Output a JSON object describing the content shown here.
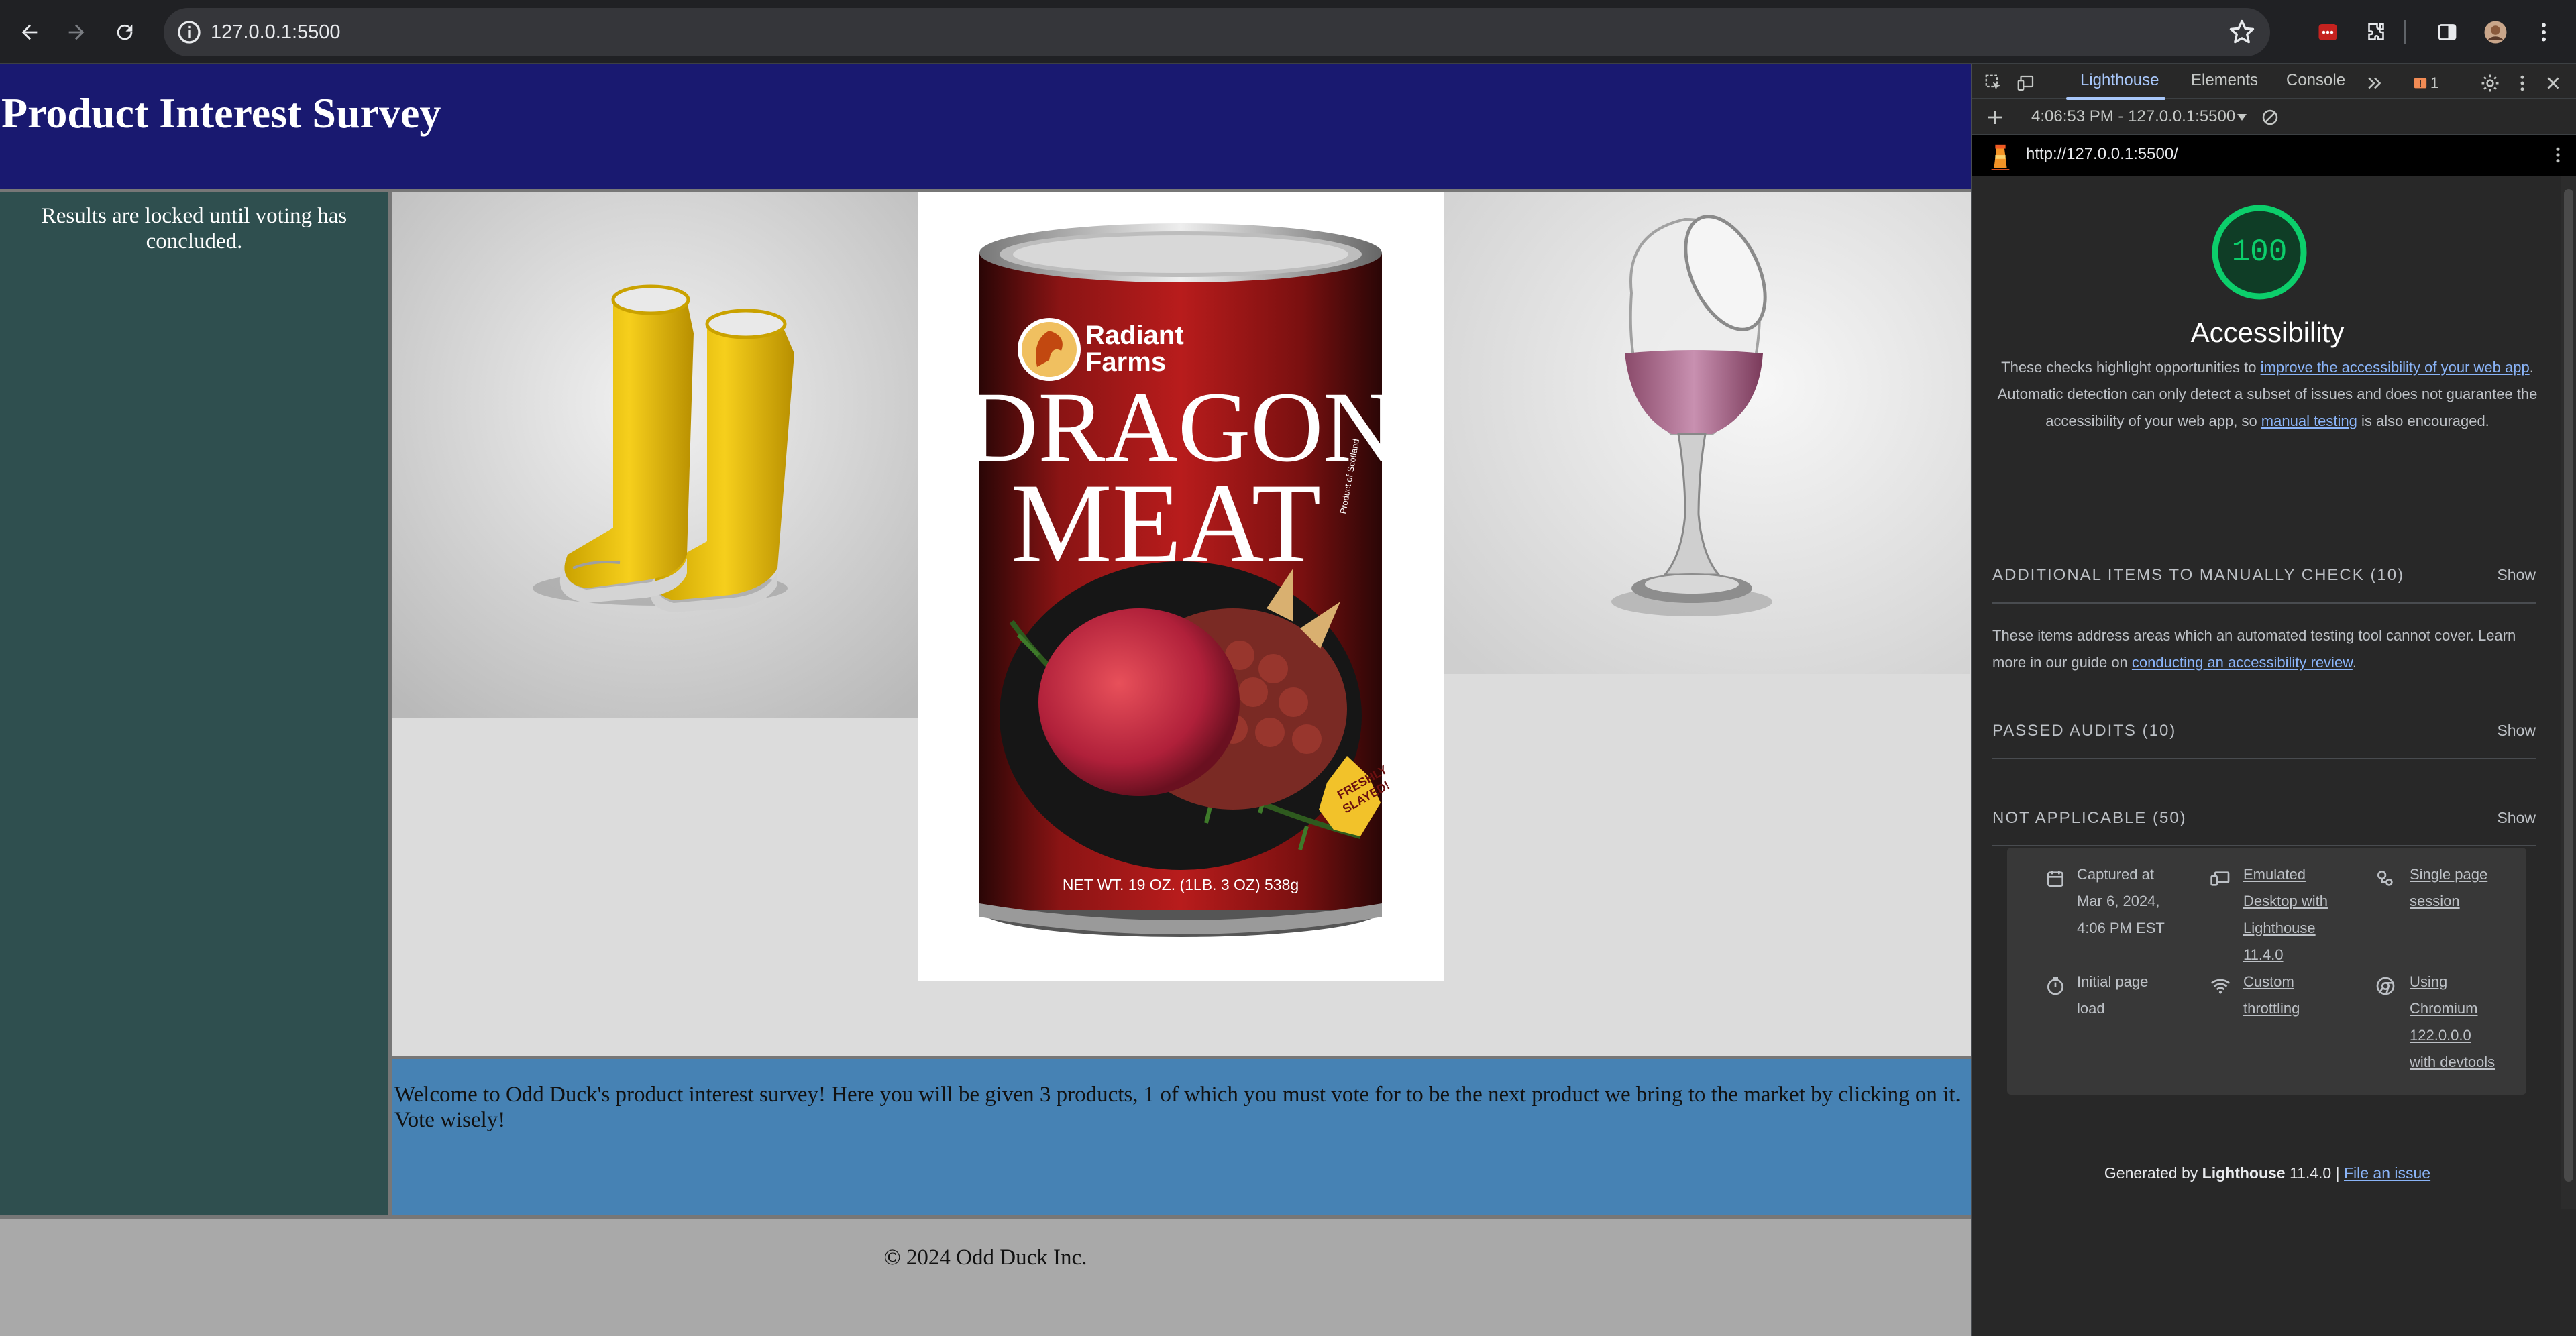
{
  "browser": {
    "url": "127.0.0.1:5500",
    "icons": [
      "back-arrow-icon",
      "forward-arrow-icon",
      "reload-icon",
      "info-icon",
      "star-icon",
      "extension-icon",
      "puzzle-icon",
      "side-panel-icon",
      "profile-avatar",
      "kebab-menu-icon"
    ]
  },
  "page": {
    "title": "Product Interest Survey",
    "sidebar_text": "Results are locked until voting has concluded.",
    "products": [
      {
        "name": "boots"
      },
      {
        "name": "dragon-meat",
        "brand_line1": "Radiant",
        "brand_line2": "Farms",
        "label_line1": "DRAGON",
        "label_line2": "MEAT",
        "net_wt": "NET WT. 19 OZ. (1LB. 3 OZ) 538g",
        "badge": "FRESHLY SLAYED!",
        "origin": "Product of Scotland"
      },
      {
        "name": "wine-glass"
      }
    ],
    "intro_text": "Welcome to Odd Duck's product interest survey! Here you will be given 3 products, 1 of which you must vote for to be the next product we bring to the market by clicking on it. Vote wisely!",
    "footer_text": "© 2024 Odd Duck Inc."
  },
  "devtools": {
    "tabs": [
      {
        "label": "Lighthouse",
        "active": true
      },
      {
        "label": "Elements"
      },
      {
        "label": "Console"
      }
    ],
    "issues_count": "1",
    "report_selector": "4:06:53 PM - 127.0.0.1:5500",
    "report_url": "http://127.0.0.1:5500/",
    "score": "100",
    "score_color": "#0cce6b",
    "category_title": "Accessibility",
    "description_pre": "These checks highlight opportunities to ",
    "description_link1": "improve the accessibility of your web app",
    "description_mid": ". Automatic detection can only detect a subset of issues and does not guarantee the accessibility of your web app, so ",
    "description_link2": "manual testing",
    "description_post": " is also encouraged.",
    "groups": [
      {
        "title": "ADDITIONAL ITEMS TO MANUALLY CHECK (10)",
        "action": "Show"
      },
      {
        "title": "PASSED AUDITS (10)",
        "action": "Show"
      },
      {
        "title": "NOT APPLICABLE (50)",
        "action": "Show"
      }
    ],
    "manual_pre": "These items address areas which an automated testing tool cannot cover. Learn more in our guide on ",
    "manual_link": "conducting an accessibility review",
    "manual_post": ".",
    "runtime": {
      "captured_line1": "Captured at",
      "captured_line2": "Mar 6, 2024,",
      "captured_line3": "4:06 PM EST",
      "device_line1": "Emulated",
      "device_line2": "Desktop with",
      "device_line3": "Lighthouse",
      "device_line4": "11.4.0",
      "session_line1": "Single page",
      "session_line2": "session",
      "load_line1": "Initial page",
      "load_line2": "load",
      "throttle_line1": "Custom",
      "throttle_line2": "throttling",
      "chromium_line1": "Using",
      "chromium_line2": "Chromium",
      "chromium_line3": "122.0.0.0",
      "chromium_line4": "with devtools"
    },
    "generated_pre": "Generated by ",
    "generated_brand": "Lighthouse",
    "generated_version": " 11.4.0 | ",
    "generated_link": "File an issue"
  }
}
